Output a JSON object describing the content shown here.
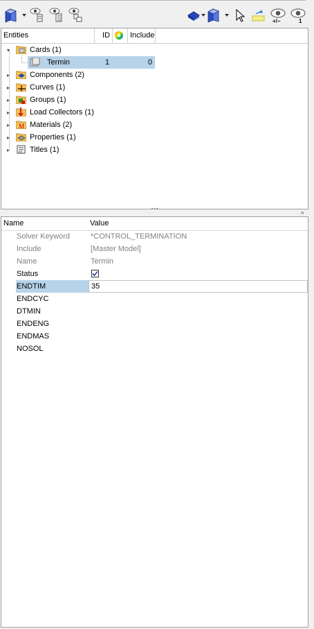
{
  "tree": {
    "columns": {
      "entities": "Entities",
      "id": "ID",
      "include": "Include"
    },
    "items": [
      {
        "label": "Cards (1)",
        "icon": "cards-folder-icon",
        "expanded": true
      },
      {
        "label": "Termin",
        "id": "1",
        "include": "0",
        "icon": "card-icon",
        "selected": true
      },
      {
        "label": "Components (2)",
        "icon": "components-folder-icon"
      },
      {
        "label": "Curves (1)",
        "icon": "curves-folder-icon"
      },
      {
        "label": "Groups (1)",
        "icon": "groups-folder-icon"
      },
      {
        "label": "Load Collectors (1)",
        "icon": "load-collectors-folder-icon"
      },
      {
        "label": "Materials (2)",
        "icon": "materials-folder-icon"
      },
      {
        "label": "Properties (1)",
        "icon": "properties-folder-icon"
      },
      {
        "label": "Titles (1)",
        "icon": "titles-folder-icon"
      }
    ]
  },
  "props": {
    "columns": {
      "name": "Name",
      "value": "Value"
    },
    "rows": [
      {
        "name": "Solver Keyword",
        "value": "*CONTROL_TERMINATION",
        "readonly": true
      },
      {
        "name": "Include",
        "value": "[Master Model]",
        "readonly": true
      },
      {
        "name": "Name",
        "value": "Termin",
        "readonly": true
      },
      {
        "name": "Status",
        "value": "",
        "checkbox": true,
        "checked": true
      },
      {
        "name": "ENDTIM",
        "value": "35",
        "editing": true
      },
      {
        "name": "ENDCYC",
        "value": ""
      },
      {
        "name": "DTMIN",
        "value": ""
      },
      {
        "name": "ENDENG",
        "value": ""
      },
      {
        "name": "ENDMAS",
        "value": ""
      },
      {
        "name": "NOSOL",
        "value": ""
      }
    ]
  },
  "toolbar": {
    "left_icons": [
      "display-mode-icon",
      "show-entity-icon",
      "show-hierarchy-icon",
      "show-all-icon"
    ],
    "right_icons": [
      "entity-selection-icon",
      "display-mode-right-icon",
      "pointer-icon",
      "highlight-icon",
      "show-hide-toggle-icon",
      "isolate-icon"
    ],
    "plus_minus_label": "+/−",
    "isolate_label": "1"
  },
  "splitter": {
    "dots": "• • •"
  },
  "colors": {
    "selection": "#b7d3ea",
    "accent_blue": "#2747b8"
  }
}
